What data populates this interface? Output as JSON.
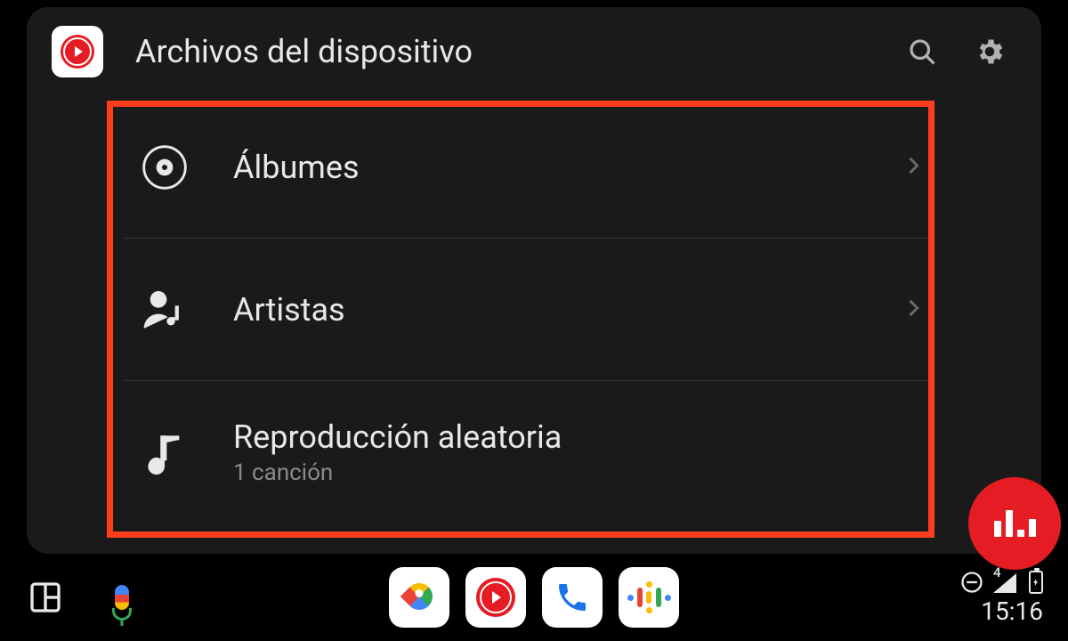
{
  "header": {
    "title": "Archivos del dispositivo"
  },
  "list": {
    "items": [
      {
        "label": "Álbumes",
        "sub": null,
        "hasChevron": true
      },
      {
        "label": "Artistas",
        "sub": null,
        "hasChevron": true
      },
      {
        "label": "Reproducción aleatoria",
        "sub": "1 canción",
        "hasChevron": false
      }
    ]
  },
  "status": {
    "clock": "15:16"
  },
  "colors": {
    "accent": "#e51c23",
    "highlight": "#ff3d1f"
  }
}
